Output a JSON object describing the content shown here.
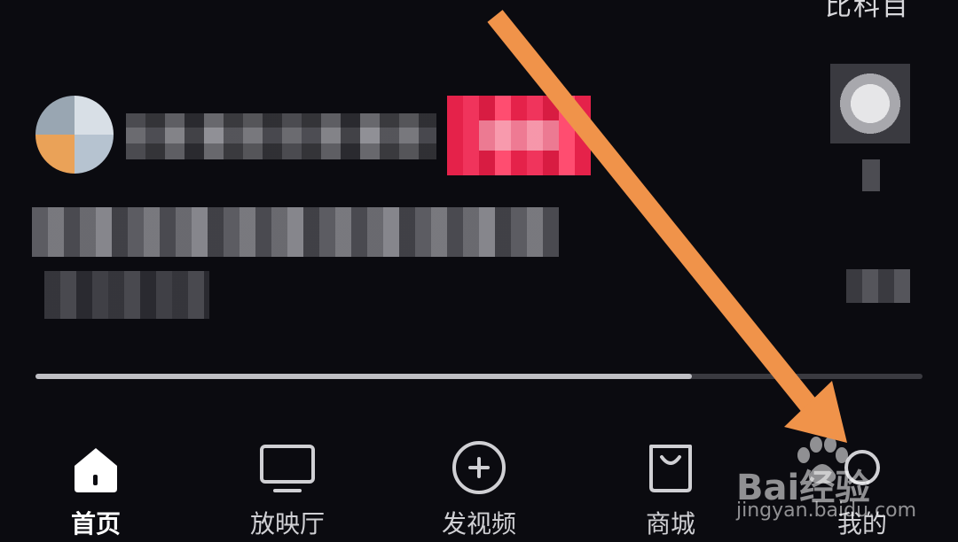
{
  "status": {
    "top_right_text": "比科目"
  },
  "progress": {
    "value_percent": 74
  },
  "nav": {
    "items": [
      {
        "label": "首页",
        "icon": "home-icon",
        "active": true
      },
      {
        "label": "放映厅",
        "icon": "tv-icon",
        "active": false
      },
      {
        "label": "发视频",
        "icon": "plus-circle-icon",
        "active": false
      },
      {
        "label": "商城",
        "icon": "shopping-bag-icon",
        "active": false
      },
      {
        "label": "我的",
        "icon": "profile-icon",
        "active": false
      }
    ]
  },
  "watermark": {
    "brand": "Bai经验",
    "url": "jingyan.baidu.com"
  },
  "colors": {
    "background": "#0b0b10",
    "follow_button": "#e5224a",
    "arrow": "#f0934a",
    "nav_text": "#d0d0d4"
  }
}
